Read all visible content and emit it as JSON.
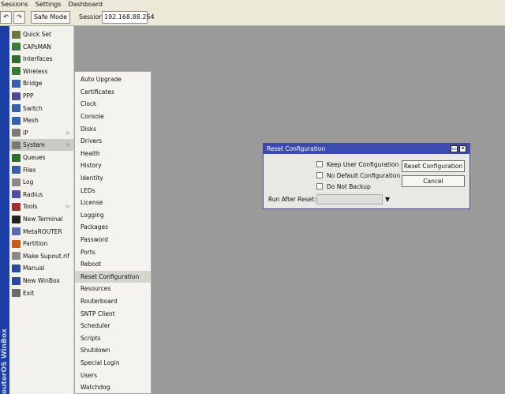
{
  "menubar": {
    "items": [
      "Sessions",
      "Settings",
      "Dashboard"
    ]
  },
  "toolbar": {
    "undo_icon": "↶",
    "redo_icon": "↷",
    "safe_mode_label": "Safe Mode",
    "session_label": "Session:",
    "session_value": "192.168.88.254"
  },
  "banner": {
    "text": "RouterOS WinBox"
  },
  "main_menu": [
    {
      "label": "Quick Set",
      "icon": "quick-set-icon",
      "color": "#6b7a3a"
    },
    {
      "label": "CAPsMAN",
      "icon": "capsman-icon",
      "color": "#3a7a3a"
    },
    {
      "label": "Interfaces",
      "icon": "interfaces-icon",
      "color": "#2f6d2f"
    },
    {
      "label": "Wireless",
      "icon": "wireless-icon",
      "color": "#3a7a3a"
    },
    {
      "label": "Bridge",
      "icon": "bridge-icon",
      "color": "#3560b0"
    },
    {
      "label": "PPP",
      "icon": "ppp-icon",
      "color": "#4a4a9a"
    },
    {
      "label": "Switch",
      "icon": "switch-icon",
      "color": "#3560b0"
    },
    {
      "label": "Mesh",
      "icon": "mesh-icon",
      "color": "#3560b0"
    },
    {
      "label": "IP",
      "icon": "ip-icon",
      "color": "#7a7a7a",
      "submenu": true
    },
    {
      "label": "System",
      "icon": "system-icon",
      "color": "#7a7a7a",
      "submenu": true
    },
    {
      "label": "Queues",
      "icon": "queues-icon",
      "color": "#2f6d2f"
    },
    {
      "label": "Files",
      "icon": "files-icon",
      "color": "#3b5ba8"
    },
    {
      "label": "Log",
      "icon": "log-icon",
      "color": "#8a8a8a"
    },
    {
      "label": "Radius",
      "icon": "radius-icon",
      "color": "#5050a0"
    },
    {
      "label": "Tools",
      "icon": "tools-icon",
      "color": "#a33030",
      "submenu": true
    },
    {
      "label": "New Terminal",
      "icon": "terminal-icon",
      "color": "#222222"
    },
    {
      "label": "MetaROUTER",
      "icon": "metarouter-icon",
      "color": "#5a6ab0"
    },
    {
      "label": "Partition",
      "icon": "partition-icon",
      "color": "#c85a20"
    },
    {
      "label": "Make Supout.rif",
      "icon": "supout-icon",
      "color": "#8a8a8a"
    },
    {
      "label": "Manual",
      "icon": "manual-icon",
      "color": "#2a4aa0"
    },
    {
      "label": "New WinBox",
      "icon": "winbox-icon",
      "color": "#2a4aa0"
    },
    {
      "label": "Exit",
      "icon": "exit-icon",
      "color": "#6a6a6a"
    }
  ],
  "submenu_arrow": "▷",
  "system_submenu": [
    "Auto Upgrade",
    "Certificates",
    "Clock",
    "Console",
    "Disks",
    "Drivers",
    "Health",
    "History",
    "Identity",
    "LEDs",
    "License",
    "Logging",
    "Packages",
    "Password",
    "Ports",
    "Reboot",
    "Reset Configuration",
    "Resources",
    "Routerboard",
    "SNTP Client",
    "Scheduler",
    "Scripts",
    "Shutdown",
    "Special Login",
    "Users",
    "Watchdog"
  ],
  "dialog": {
    "title": "Reset Configuration",
    "minimize_icon": "▭",
    "close_icon": "✕",
    "keep_user_config": "Keep User Configuration",
    "no_default_config": "No Default Configuration",
    "do_not_backup": "Do Not Backup",
    "reset_button": "Reset Configuration",
    "cancel_button": "Cancel",
    "run_after_reset_label": "Run After Reset:",
    "run_after_reset_value": "",
    "dropdown_icon": "▼"
  }
}
